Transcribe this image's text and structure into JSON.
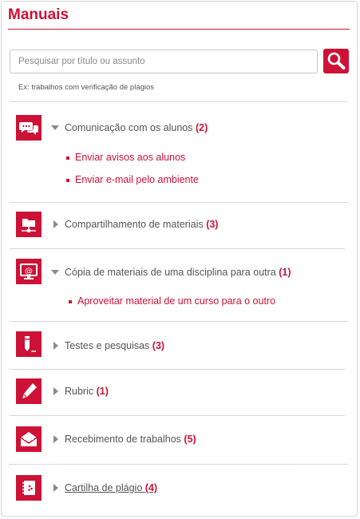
{
  "title": "Manuais",
  "search": {
    "placeholder": "Pesquisar por título ou assunto",
    "hint": "Ex: trabalhos com verificação de plágios"
  },
  "colors": {
    "accent": "#cc1236",
    "text": "#555555"
  },
  "sections": [
    {
      "icon": "chat-bubbles-icon",
      "label": "Comunicação com os alunos",
      "count": "(2)",
      "expanded": true,
      "items": [
        "Enviar avisos aos alunos",
        "Enviar e-mail pelo ambiente"
      ]
    },
    {
      "icon": "shared-folder-icon",
      "label": "Compartilhamento de materiais",
      "count": "(3)",
      "expanded": false
    },
    {
      "icon": "monitor-at-icon",
      "label": "Cópia de materiais de uma disciplina para outra",
      "count": "(1)",
      "expanded": true,
      "items": [
        "Aproveitar material de um curso para o outro"
      ]
    },
    {
      "icon": "pencil-test-icon",
      "label": "Testes e pesquisas",
      "count": "(3)",
      "expanded": false
    },
    {
      "icon": "pen-icon",
      "label": "Rubric",
      "count": "(1)",
      "expanded": false
    },
    {
      "icon": "envelope-icon",
      "label": "Recebimento de trabalhos",
      "count": "(5)",
      "expanded": false
    },
    {
      "icon": "notebook-icon",
      "label": "Cartilha de plágio",
      "count": "(4)",
      "expanded": false
    }
  ]
}
